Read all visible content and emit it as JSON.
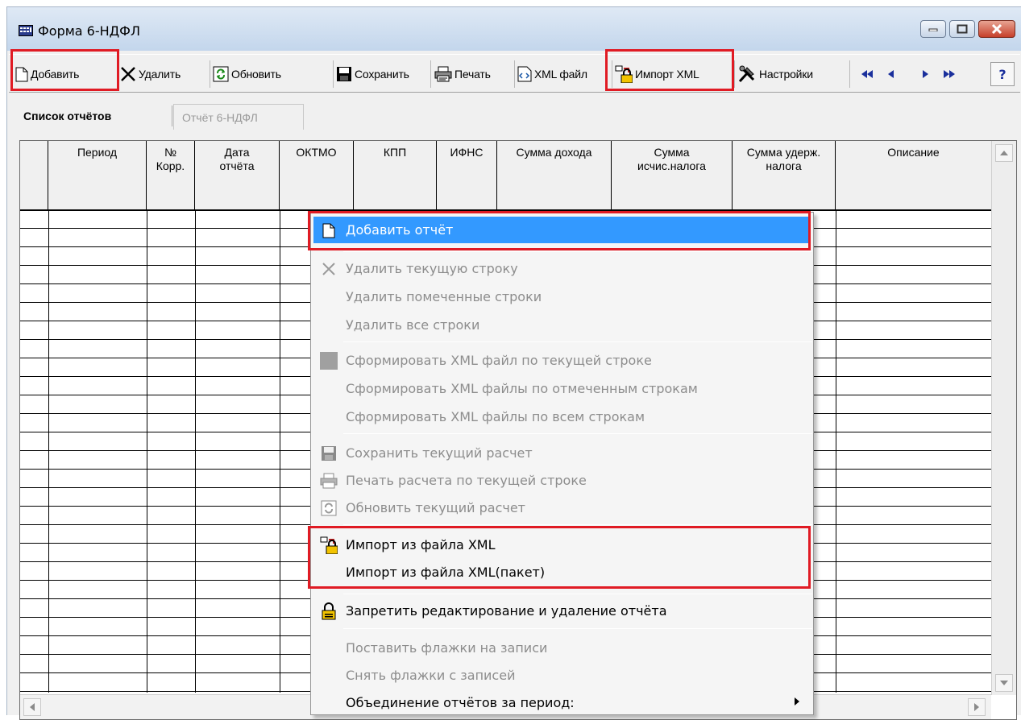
{
  "window": {
    "title": "Форма 6-НДФЛ"
  },
  "toolbar": {
    "add": "Добавить",
    "delete": "Удалить",
    "refresh": "Обновить",
    "save": "Сохранить",
    "print": "Печать",
    "xml_file": "XML файл",
    "import_xml": "Импорт XML",
    "settings": "Настройки",
    "help": "?"
  },
  "tabs": {
    "list": "Список отчётов",
    "report": "Отчёт 6-НДФЛ"
  },
  "grid": {
    "columns": [
      {
        "line1": "Период",
        "line2": ""
      },
      {
        "line1": "№",
        "line2": "Корр."
      },
      {
        "line1": "Дата",
        "line2": "отчёта"
      },
      {
        "line1": "ОКТМО",
        "line2": ""
      },
      {
        "line1": "КПП",
        "line2": ""
      },
      {
        "line1": "ИФНС",
        "line2": ""
      },
      {
        "line1": "Сумма дохода",
        "line2": ""
      },
      {
        "line1": "Сумма",
        "line2": "исчис.налога"
      },
      {
        "line1": "Сумма удерж.",
        "line2": "налога"
      },
      {
        "line1": "Описание",
        "line2": ""
      }
    ]
  },
  "context_menu": {
    "items": {
      "add_report": "Добавить отчёт",
      "delete_current": "Удалить текущую строку",
      "delete_marked": "Удалить помеченные строки",
      "delete_all": "Удалить все строки",
      "xml_current": "Сформировать XML файл по текущей строке",
      "xml_marked": "Сформировать XML файлы по отмеченным строкам",
      "xml_all": "Сформировать XML файлы по всем строкам",
      "save_current": "Сохранить текущий расчет",
      "print_current": "Печать расчета по текущей строке",
      "refresh_current": "Обновить текущий расчет",
      "import_xml": "Импорт из файла XML",
      "import_xml_batch": "Импорт из файла XML(пакет)",
      "lock": "Запретить редактирование и удаление отчёта",
      "set_flags": "Поставить флажки на записи",
      "clear_flags": "Снять флажки с записей",
      "merge": "Объединение отчётов за период:"
    }
  },
  "colors": {
    "highlight": "#e01b24",
    "menu_selected": "#3399ff"
  }
}
